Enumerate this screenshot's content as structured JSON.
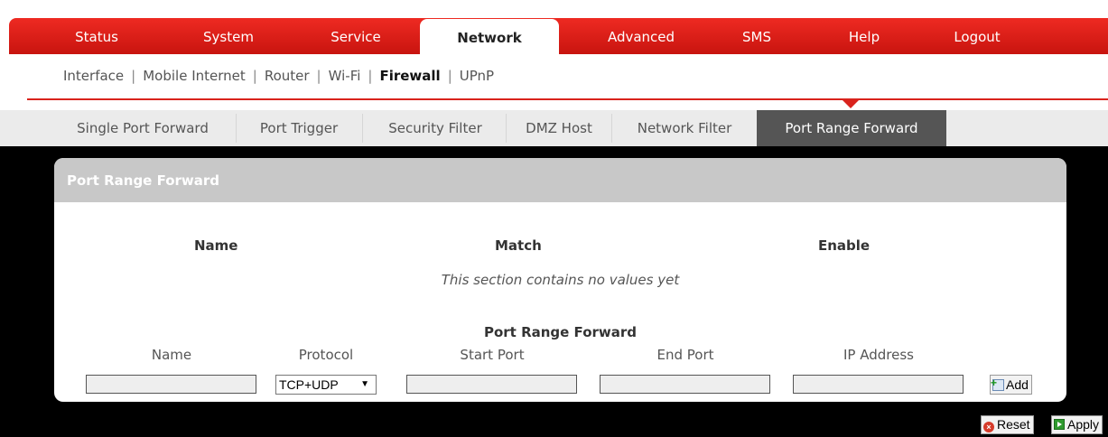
{
  "main_nav": [
    {
      "label": "Status",
      "active": false
    },
    {
      "label": "System",
      "active": false
    },
    {
      "label": "Service",
      "active": false
    },
    {
      "label": "Network",
      "active": true
    },
    {
      "label": "Advanced",
      "active": false
    },
    {
      "label": "SMS",
      "active": false
    },
    {
      "label": "Help",
      "active": false
    },
    {
      "label": "Logout",
      "active": false
    }
  ],
  "sub_nav": [
    {
      "label": "Interface",
      "active": false
    },
    {
      "label": "Mobile Internet",
      "active": false
    },
    {
      "label": "Router",
      "active": false
    },
    {
      "label": "Wi-Fi",
      "active": false
    },
    {
      "label": "Firewall",
      "active": true
    },
    {
      "label": "UPnP",
      "active": false
    }
  ],
  "sub_nav_separator": "|",
  "tabs": [
    {
      "label": "Single Port Forward",
      "active": false
    },
    {
      "label": "Port Trigger",
      "active": false
    },
    {
      "label": "Security Filter",
      "active": false
    },
    {
      "label": "DMZ Host",
      "active": false
    },
    {
      "label": "Network Filter",
      "active": false
    },
    {
      "label": "Port Range Forward",
      "active": true
    }
  ],
  "panel": {
    "title": "Port Range Forward",
    "columns": [
      "Name",
      "Match",
      "Enable"
    ],
    "empty_message": "This section contains no values yet",
    "form": {
      "title": "Port Range Forward",
      "labels": {
        "name": "Name",
        "protocol": "Protocol",
        "start_port": "Start Port",
        "end_port": "End Port",
        "ip_address": "IP Address"
      },
      "values": {
        "name": "",
        "start_port": "",
        "end_port": "",
        "ip_address": ""
      },
      "protocol_selected": "TCP+UDP",
      "add_label": "Add"
    }
  },
  "buttons": {
    "reset": "Reset",
    "apply": "Apply"
  },
  "colors": {
    "brand_red": "#d9231d",
    "active_tab": "#555555",
    "panel_header": "#c8c8c8",
    "background": "#000000"
  },
  "icons": {
    "add": "add-document-icon",
    "reset": "reset-icon",
    "apply": "apply-icon",
    "select_caret": "caret-down-icon"
  }
}
